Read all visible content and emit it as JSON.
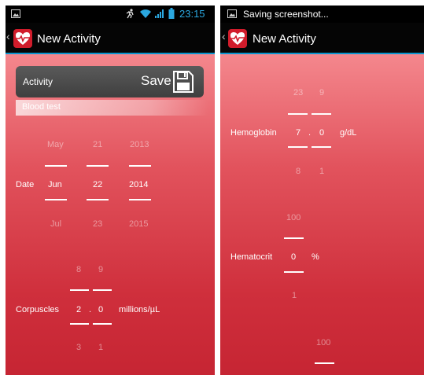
{
  "left": {
    "status": {
      "time": "23:15"
    },
    "title": "New Activity",
    "save_label": "Save",
    "activity_label": "Activity",
    "activity_value": "Blood test",
    "date": {
      "label": "Date",
      "prev": [
        "May",
        "21",
        "2013"
      ],
      "curr": [
        "Jun",
        "22",
        "2014"
      ],
      "next": [
        "Jul",
        "23",
        "2015"
      ]
    },
    "corpuscles": {
      "label": "Corpuscles",
      "prev": [
        "8",
        "9"
      ],
      "curr": [
        "2",
        "0"
      ],
      "next": [
        "3",
        "1"
      ],
      "sep": ".",
      "unit": "millions/µL"
    }
  },
  "right": {
    "status": {
      "notice": "Saving screenshot..."
    },
    "title": "New Activity",
    "hemoglobin": {
      "label": "Hemoglobin",
      "prev": [
        "23",
        "9"
      ],
      "curr": [
        "7",
        "0"
      ],
      "next": [
        "8",
        "1"
      ],
      "sep": ".",
      "unit": "g/dL"
    },
    "hematocrit": {
      "label": "Hematocrit",
      "prev": "100",
      "curr": "0",
      "next": "1",
      "unit": "%"
    },
    "extra_picker": {
      "prev": "100"
    }
  },
  "colors": {
    "accent": "#0a96cf",
    "brand_red": "#d11c2b"
  }
}
